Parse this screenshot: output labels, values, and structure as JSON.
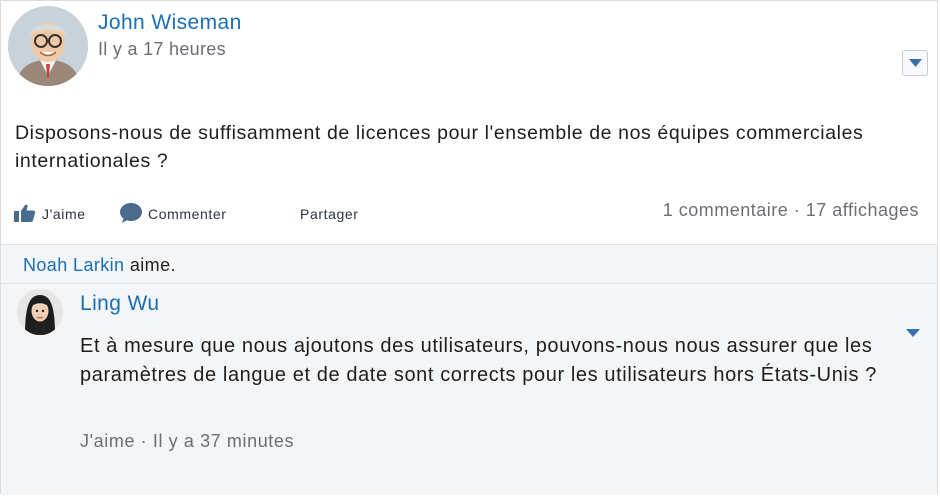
{
  "post": {
    "author": "John Wiseman",
    "time": "Il y a 17 heures",
    "text": "Disposons-nous de suffisamment de licences pour l'ensemble de nos équipes commerciales internationales ?",
    "actions": {
      "like": "J'aime",
      "comment": "Commenter",
      "share": "Partager"
    },
    "stats": "1 commentaire · 17 affichages"
  },
  "likes": {
    "name": "Noah Larkin",
    "suffix": " aime."
  },
  "comment": {
    "author": "Ling Wu",
    "text": "Et à mesure que nous ajoutons des utilisateurs, pouvons-nous nous assurer que les paramètres de langue et de date sont corrects pour les utilisateurs hors États-Unis ?",
    "like": "J'aime",
    "separator": " · ",
    "time": "Il y a 37 minutes"
  },
  "colors": {
    "link": "#1a6fb4",
    "muted": "#6b6f74",
    "panel": "#f3f5f7"
  },
  "icons": {
    "menu": "chevron-down-icon",
    "like": "thumbs-up-icon",
    "comment": "speech-bubble-icon"
  }
}
